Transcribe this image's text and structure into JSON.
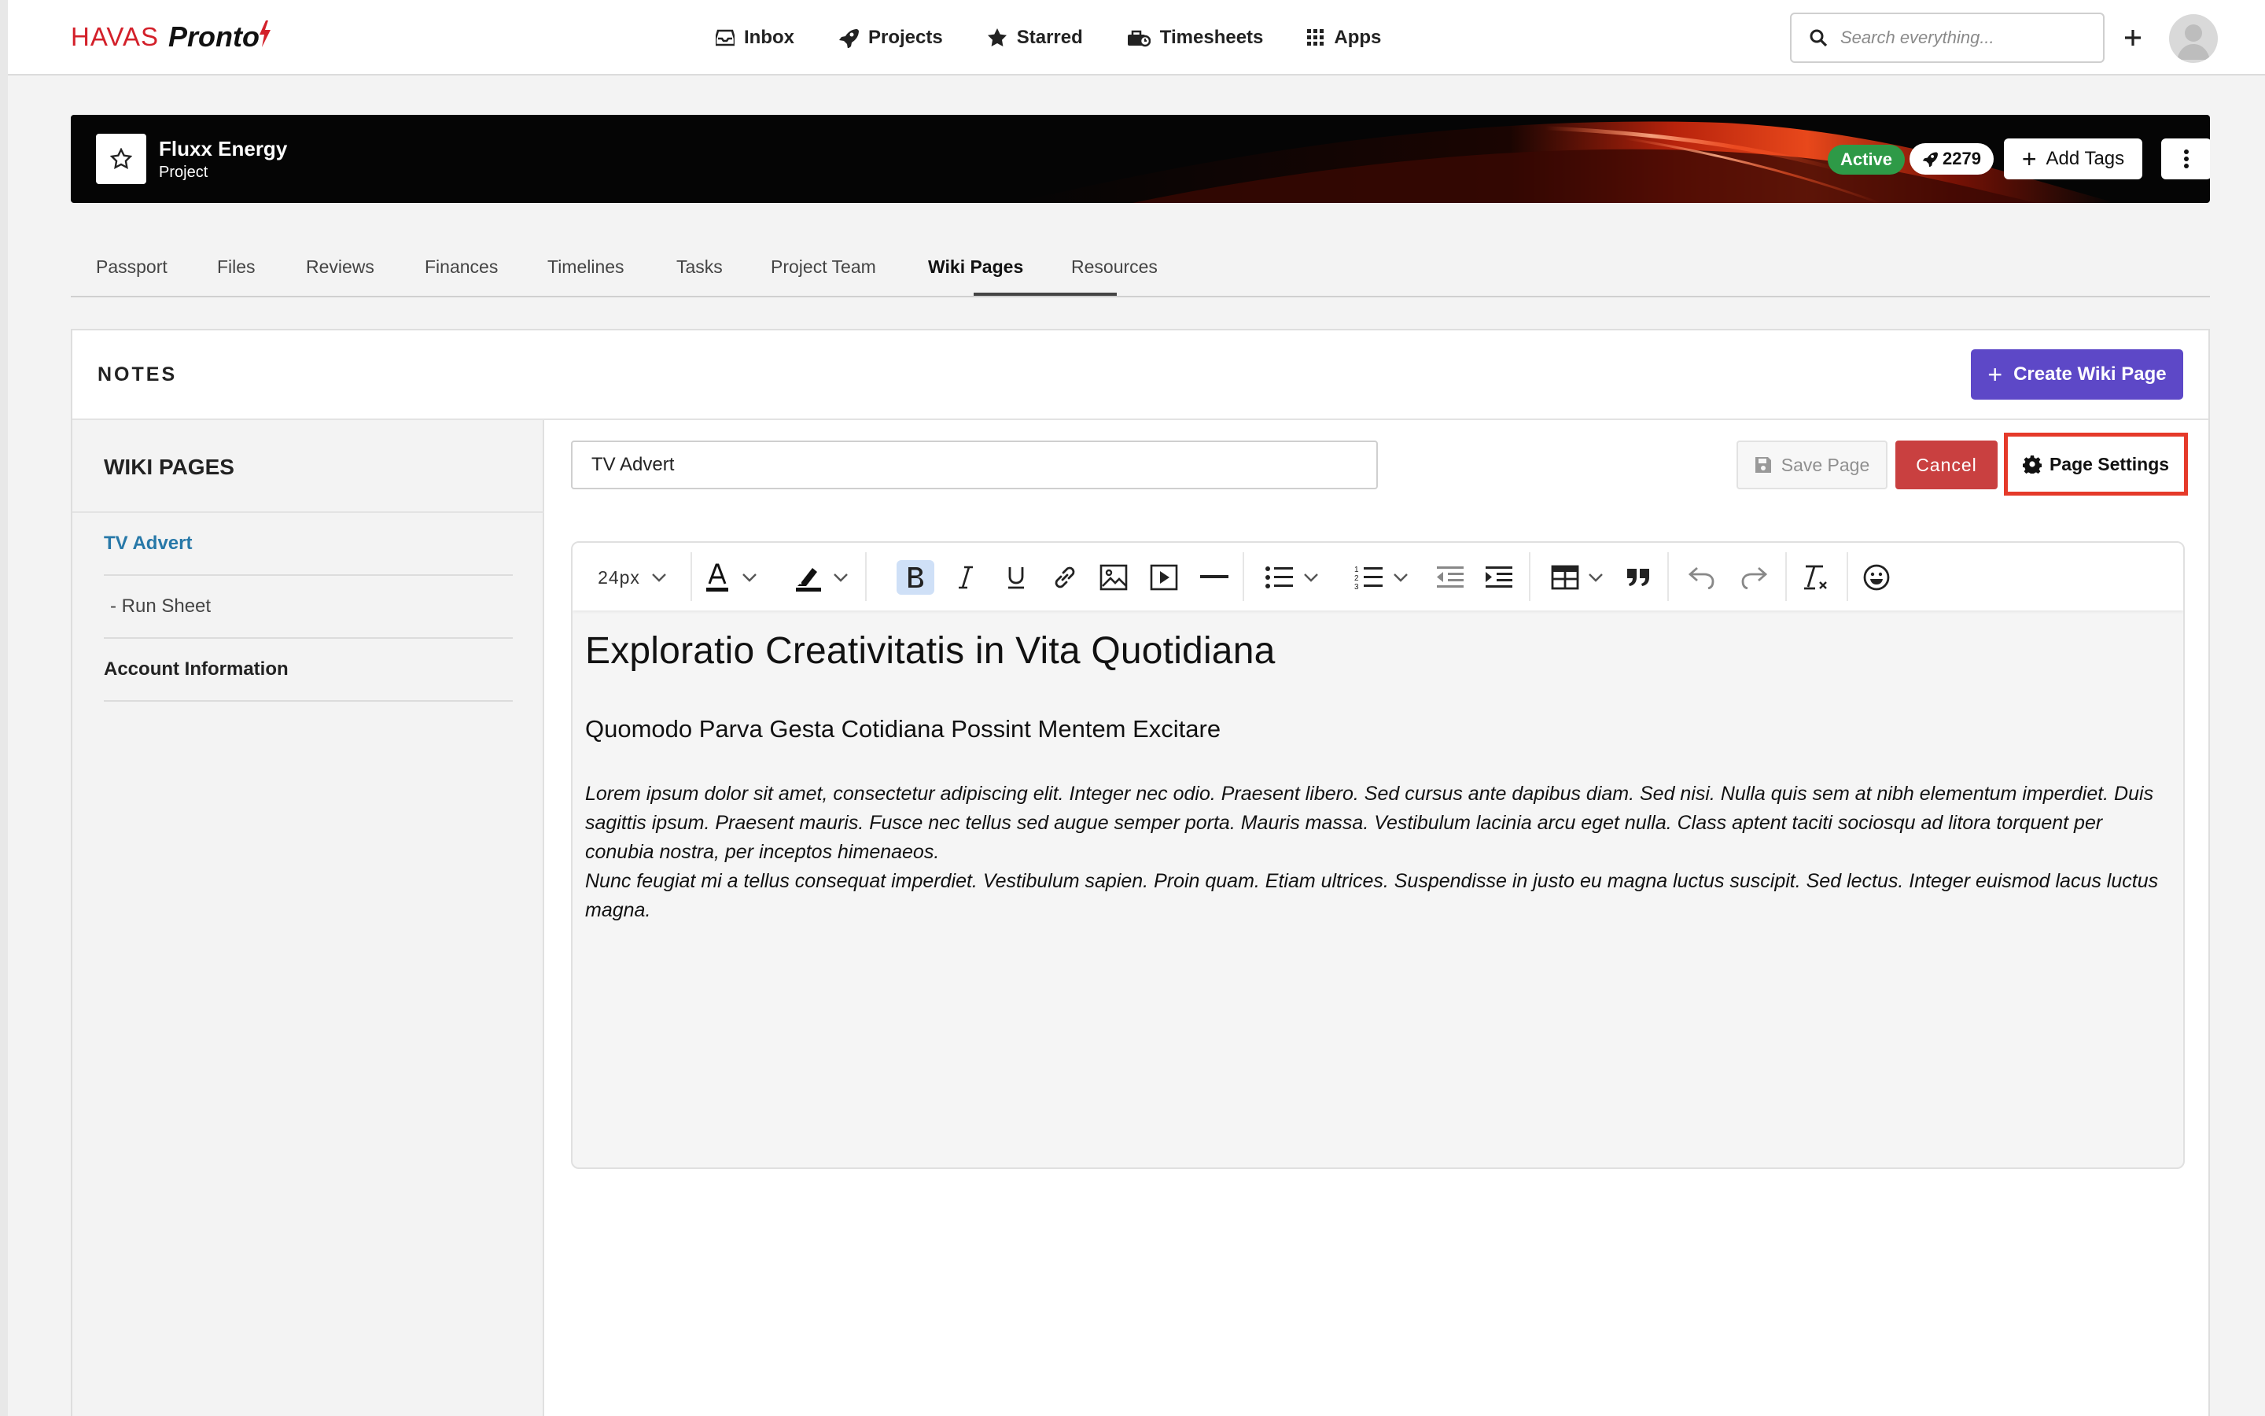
{
  "app": {
    "logo_havas": "HAVAS",
    "logo_pronto": "Pronto",
    "logo_bolt": "?"
  },
  "nav": {
    "items": [
      {
        "label": "Inbox",
        "icon": "inbox-icon"
      },
      {
        "label": "Projects",
        "icon": "rocket-icon"
      },
      {
        "label": "Starred",
        "icon": "star-icon"
      },
      {
        "label": "Timesheets",
        "icon": "timesheets-icon"
      },
      {
        "label": "Apps",
        "icon": "apps-grid-icon"
      }
    ],
    "search_placeholder": "Search everything..."
  },
  "project": {
    "name": "Fluxx Energy",
    "type": "Project",
    "status": "Active",
    "count": "2279",
    "add_tags_label": "Add Tags",
    "status_color": "#2e9a47"
  },
  "tabs": [
    "Passport",
    "Files",
    "Reviews",
    "Finances",
    "Timelines",
    "Tasks",
    "Project Team",
    "Wiki Pages",
    "Resources"
  ],
  "active_tab": "Wiki Pages",
  "panel": {
    "title": "NOTES",
    "create_label": "Create Wiki Page",
    "create_color": "#5d48c7"
  },
  "sidebar": {
    "heading": "WIKI PAGES",
    "items": [
      {
        "label": "TV Advert"
      },
      {
        "label": "- Run Sheet"
      },
      {
        "label": "Account Information"
      }
    ]
  },
  "editor": {
    "title_value": "TV Advert",
    "save_label": "Save Page",
    "cancel_label": "Cancel",
    "settings_label": "Page Settings",
    "font_size": "24px",
    "heading": "Exploratio Creativitatis in Vita Quotidiana",
    "subheading": "Quomodo Parva Gesta Cotidiana Possint Mentem Excitare",
    "paragraph1": "Lorem ipsum dolor sit amet, consectetur adipiscing elit. Integer nec odio. Praesent libero. Sed cursus ante dapibus diam. Sed nisi. Nulla quis sem at nibh elementum imperdiet. Duis sagittis ipsum. Praesent mauris. Fusce nec tellus sed augue semper porta. Mauris massa. Vestibulum lacinia arcu eget nulla. Class aptent taciti sociosqu ad litora torquent per conubia nostra, per inceptos himenaeos.",
    "paragraph2": "Nunc feugiat mi a tellus consequat imperdiet. Vestibulum sapien. Proin quam. Etiam ultrices. Suspendisse in justo eu magna luctus suscipit. Sed lectus. Integer euismod lacus luctus magna."
  }
}
